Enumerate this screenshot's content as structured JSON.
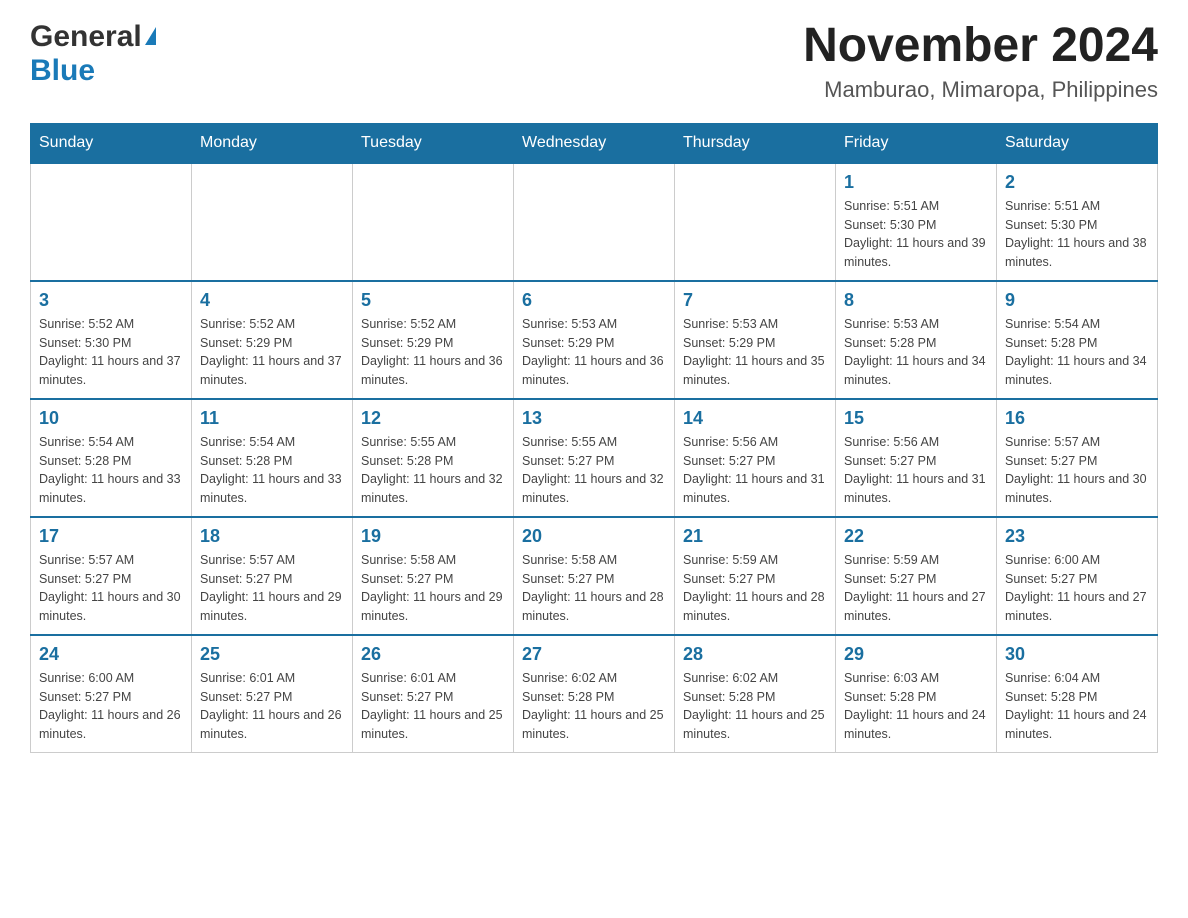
{
  "header": {
    "logo_general": "General",
    "logo_blue": "Blue",
    "title": "November 2024",
    "subtitle": "Mamburao, Mimaropa, Philippines"
  },
  "days_of_week": [
    "Sunday",
    "Monday",
    "Tuesday",
    "Wednesday",
    "Thursday",
    "Friday",
    "Saturday"
  ],
  "weeks": [
    {
      "days": [
        {
          "number": "",
          "info": "",
          "empty": true
        },
        {
          "number": "",
          "info": "",
          "empty": true
        },
        {
          "number": "",
          "info": "",
          "empty": true
        },
        {
          "number": "",
          "info": "",
          "empty": true
        },
        {
          "number": "",
          "info": "",
          "empty": true
        },
        {
          "number": "1",
          "info": "Sunrise: 5:51 AM\nSunset: 5:30 PM\nDaylight: 11 hours and 39 minutes."
        },
        {
          "number": "2",
          "info": "Sunrise: 5:51 AM\nSunset: 5:30 PM\nDaylight: 11 hours and 38 minutes."
        }
      ]
    },
    {
      "days": [
        {
          "number": "3",
          "info": "Sunrise: 5:52 AM\nSunset: 5:30 PM\nDaylight: 11 hours and 37 minutes."
        },
        {
          "number": "4",
          "info": "Sunrise: 5:52 AM\nSunset: 5:29 PM\nDaylight: 11 hours and 37 minutes."
        },
        {
          "number": "5",
          "info": "Sunrise: 5:52 AM\nSunset: 5:29 PM\nDaylight: 11 hours and 36 minutes."
        },
        {
          "number": "6",
          "info": "Sunrise: 5:53 AM\nSunset: 5:29 PM\nDaylight: 11 hours and 36 minutes."
        },
        {
          "number": "7",
          "info": "Sunrise: 5:53 AM\nSunset: 5:29 PM\nDaylight: 11 hours and 35 minutes."
        },
        {
          "number": "8",
          "info": "Sunrise: 5:53 AM\nSunset: 5:28 PM\nDaylight: 11 hours and 34 minutes."
        },
        {
          "number": "9",
          "info": "Sunrise: 5:54 AM\nSunset: 5:28 PM\nDaylight: 11 hours and 34 minutes."
        }
      ]
    },
    {
      "days": [
        {
          "number": "10",
          "info": "Sunrise: 5:54 AM\nSunset: 5:28 PM\nDaylight: 11 hours and 33 minutes."
        },
        {
          "number": "11",
          "info": "Sunrise: 5:54 AM\nSunset: 5:28 PM\nDaylight: 11 hours and 33 minutes."
        },
        {
          "number": "12",
          "info": "Sunrise: 5:55 AM\nSunset: 5:28 PM\nDaylight: 11 hours and 32 minutes."
        },
        {
          "number": "13",
          "info": "Sunrise: 5:55 AM\nSunset: 5:27 PM\nDaylight: 11 hours and 32 minutes."
        },
        {
          "number": "14",
          "info": "Sunrise: 5:56 AM\nSunset: 5:27 PM\nDaylight: 11 hours and 31 minutes."
        },
        {
          "number": "15",
          "info": "Sunrise: 5:56 AM\nSunset: 5:27 PM\nDaylight: 11 hours and 31 minutes."
        },
        {
          "number": "16",
          "info": "Sunrise: 5:57 AM\nSunset: 5:27 PM\nDaylight: 11 hours and 30 minutes."
        }
      ]
    },
    {
      "days": [
        {
          "number": "17",
          "info": "Sunrise: 5:57 AM\nSunset: 5:27 PM\nDaylight: 11 hours and 30 minutes."
        },
        {
          "number": "18",
          "info": "Sunrise: 5:57 AM\nSunset: 5:27 PM\nDaylight: 11 hours and 29 minutes."
        },
        {
          "number": "19",
          "info": "Sunrise: 5:58 AM\nSunset: 5:27 PM\nDaylight: 11 hours and 29 minutes."
        },
        {
          "number": "20",
          "info": "Sunrise: 5:58 AM\nSunset: 5:27 PM\nDaylight: 11 hours and 28 minutes."
        },
        {
          "number": "21",
          "info": "Sunrise: 5:59 AM\nSunset: 5:27 PM\nDaylight: 11 hours and 28 minutes."
        },
        {
          "number": "22",
          "info": "Sunrise: 5:59 AM\nSunset: 5:27 PM\nDaylight: 11 hours and 27 minutes."
        },
        {
          "number": "23",
          "info": "Sunrise: 6:00 AM\nSunset: 5:27 PM\nDaylight: 11 hours and 27 minutes."
        }
      ]
    },
    {
      "days": [
        {
          "number": "24",
          "info": "Sunrise: 6:00 AM\nSunset: 5:27 PM\nDaylight: 11 hours and 26 minutes."
        },
        {
          "number": "25",
          "info": "Sunrise: 6:01 AM\nSunset: 5:27 PM\nDaylight: 11 hours and 26 minutes."
        },
        {
          "number": "26",
          "info": "Sunrise: 6:01 AM\nSunset: 5:27 PM\nDaylight: 11 hours and 25 minutes."
        },
        {
          "number": "27",
          "info": "Sunrise: 6:02 AM\nSunset: 5:28 PM\nDaylight: 11 hours and 25 minutes."
        },
        {
          "number": "28",
          "info": "Sunrise: 6:02 AM\nSunset: 5:28 PM\nDaylight: 11 hours and 25 minutes."
        },
        {
          "number": "29",
          "info": "Sunrise: 6:03 AM\nSunset: 5:28 PM\nDaylight: 11 hours and 24 minutes."
        },
        {
          "number": "30",
          "info": "Sunrise: 6:04 AM\nSunset: 5:28 PM\nDaylight: 11 hours and 24 minutes."
        }
      ]
    }
  ]
}
